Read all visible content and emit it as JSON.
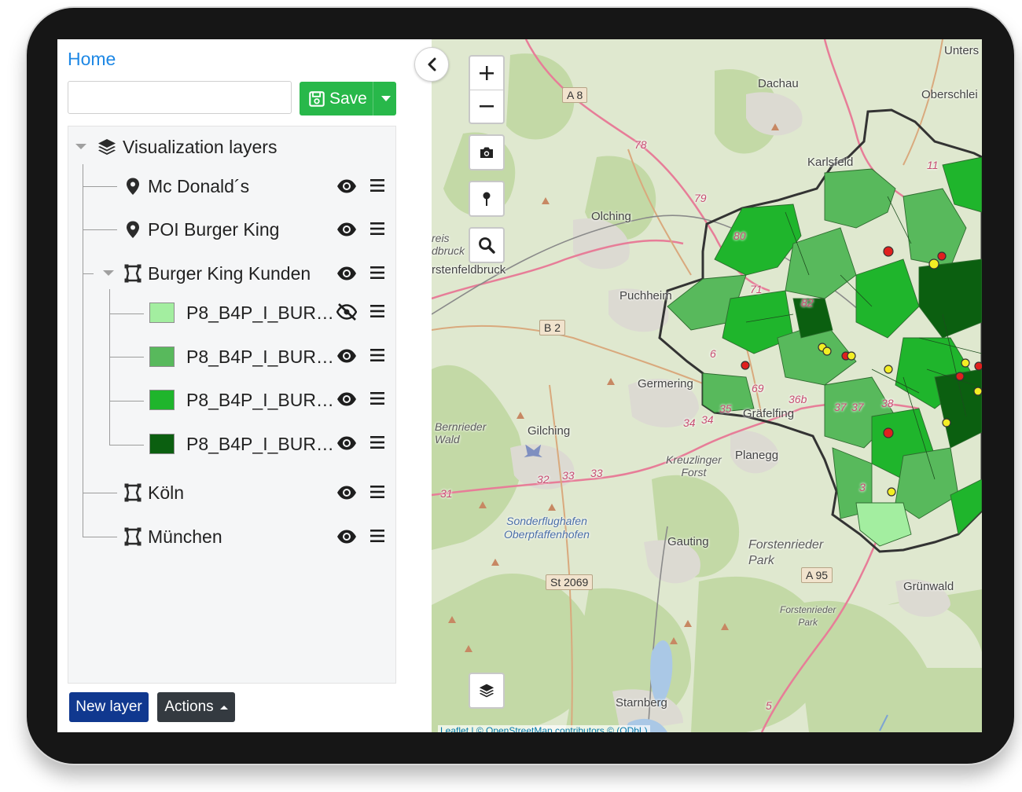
{
  "panel": {
    "home_label": "Home",
    "name_input": {
      "value": "",
      "placeholder": ""
    },
    "save_label": "Save",
    "tree": {
      "root_label": "Visualization layers",
      "layers": [
        {
          "label": "Mc Donald´s",
          "icon": "map-marker-icon",
          "visibility": "visible"
        },
        {
          "label": "POI Burger King",
          "icon": "map-marker-icon",
          "visibility": "visible"
        },
        {
          "label": "Burger King Kunden",
          "icon": "polygon-icon",
          "visibility": "visible",
          "expanded": true,
          "sublayers": [
            {
              "label": "P8_B4P_I_BUR…",
              "color": "#a3eea0",
              "visibility": "hidden"
            },
            {
              "label": "P8_B4P_I_BUR…",
              "color": "#58b95c",
              "visibility": "visible"
            },
            {
              "label": "P8_B4P_I_BUR…",
              "color": "#1fb52c",
              "visibility": "visible"
            },
            {
              "label": "P8_B4P_I_BUR…",
              "color": "#0b5f10",
              "visibility": "visible"
            }
          ]
        },
        {
          "label": "Köln",
          "icon": "polygon-icon",
          "visibility": "visible"
        },
        {
          "label": "München",
          "icon": "polygon-icon",
          "visibility": "visible"
        }
      ]
    },
    "new_layer_label": "New layer",
    "actions_label": "Actions"
  },
  "map": {
    "places": {
      "dachau": "Dachau",
      "karlsfeld": "Karlsfeld",
      "olching": "Olching",
      "puchheim": "Puchheim",
      "germering": "Germering",
      "grafelfing": "Gräfelfing",
      "gilching": "Gilching",
      "planegg": "Planegg",
      "gauting": "Gauting",
      "grunwald": "Grünwald",
      "starnberg": "Starnberg",
      "unters": "Unters",
      "oberschlei": "Oberschlei",
      "fursten": "rstenfeldbruck",
      "reis": "reis",
      "dbruck": "dbruck"
    },
    "forests": {
      "bernried": "Bernrieder\nWald",
      "kreuzlinger": "Kreuzlinger\nForst",
      "forstenried": "Forstenrieder\nPark",
      "forstenried_small": "Forstenrieder\nPark"
    },
    "airport": "Sonderflughafen\nOberpfaffenhofen",
    "roads": {
      "a8": "A 8",
      "b2": "B 2",
      "st2069": "St 2069",
      "a95": "A 95",
      "r78": "78",
      "r79": "79",
      "r80": "80",
      "r82": "82",
      "r71": "71",
      "r6": "6",
      "r11": "11",
      "r35": "35",
      "r34": "34",
      "r34b": "34",
      "r36b": "36b",
      "r37": "37",
      "r37b": "37",
      "r38": "38",
      "r32": "32",
      "r33": "33",
      "r33b": "33",
      "r31": "31",
      "r69": "69",
      "r3": "3",
      "r5": "5"
    },
    "attribution": "Leaflet | © OpenStreetMap contributors © (ODbL)"
  },
  "colors": {
    "accent_blue": "#1e88e5",
    "save_green": "#28b84a",
    "new_layer_blue": "#10388f",
    "actions_dark": "#343a40",
    "poi_red": "#e0201e",
    "poi_yellow": "#f3ee24"
  }
}
